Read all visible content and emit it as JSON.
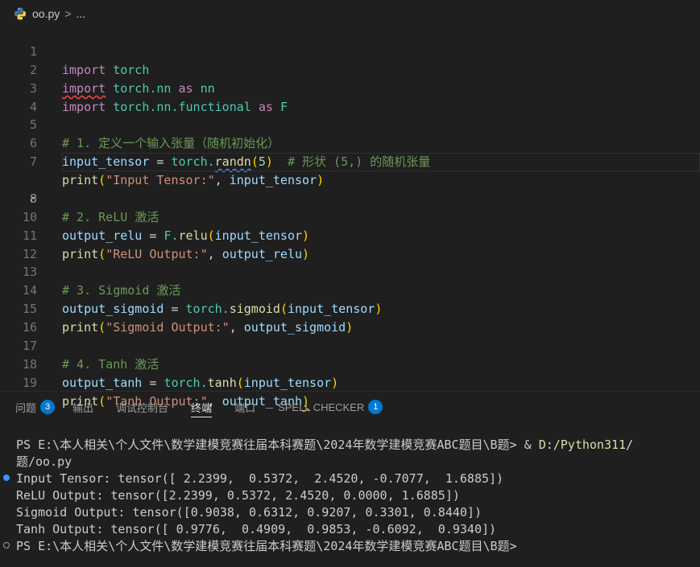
{
  "breadcrumb": {
    "file": "oo.py",
    "separator": ">",
    "more": "..."
  },
  "editor": {
    "lines": [
      {
        "n": "1"
      },
      {
        "n": "2"
      },
      {
        "n": "3"
      },
      {
        "n": "4"
      },
      {
        "n": "5"
      },
      {
        "n": "6"
      },
      {
        "n": "7"
      },
      {
        "n": "8"
      },
      {
        "n": "9"
      },
      {
        "n": "10"
      },
      {
        "n": "11"
      },
      {
        "n": "12"
      },
      {
        "n": "13"
      },
      {
        "n": "14"
      },
      {
        "n": "15"
      },
      {
        "n": "16"
      },
      {
        "n": "17"
      },
      {
        "n": "18"
      },
      {
        "n": "19"
      }
    ],
    "t": {
      "import": "import",
      "torch": "torch",
      "torch_nn": "torch.nn",
      "as": "as",
      "nn": "nn",
      "torch_nn_functional": "torch.nn.functional",
      "F": "F",
      "c1": "# 1. 定义一个输入张量（随机初始化）",
      "input_tensor": "input_tensor",
      "eq": " = ",
      "torch_dot": "torch.",
      "randn": "randn",
      "five": "5",
      "c6": "# 形状 (5,) 的随机张量",
      "print": "print",
      "s7": "\"Input Tensor:\"",
      "comma": ", ",
      "c9": "# 2. ReLU 激活",
      "output_relu": "output_relu",
      "F_dot": "F.",
      "relu": "relu",
      "s11": "\"ReLU Output:\"",
      "c13": "# 3. Sigmoid 激活",
      "output_sigmoid": "output_sigmoid",
      "sigmoid": "sigmoid",
      "s15": "\"Sigmoid Output:\"",
      "c17": "# 4. Tanh 激活",
      "output_tanh": "output_tanh",
      "tanh": "tanh",
      "s19": "\"Tanh Output:\""
    }
  },
  "panel": {
    "tabs": [
      {
        "label": "问题",
        "badge": "3"
      },
      {
        "label": "输出"
      },
      {
        "label": "调试控制台"
      },
      {
        "label": "终端"
      },
      {
        "label": "端口"
      },
      {
        "label": "SPELL CHECKER",
        "badge": "1"
      }
    ]
  },
  "terminal": {
    "prompt1": "PS E:\\本人相关\\个人文件\\数学建模竞赛往届本科赛题\\2024年数学建模竞赛ABC题目\\B题> & ",
    "cmd_path": "D:/Python311/",
    "wrap": "题/oo.py",
    "out1": "Input Tensor: tensor([ 2.2399,  0.5372,  2.4520, -0.7077,  1.6885])",
    "out2": "ReLU Output: tensor([2.2399, 0.5372, 2.4520, 0.0000, 1.6885])",
    "out3": "Sigmoid Output: tensor([0.9038, 0.6312, 0.9207, 0.3301, 0.8440])",
    "out4": "Tanh Output: tensor([ 0.9776,  0.4909,  0.9853, -0.6092,  0.9340])",
    "prompt2": "PS E:\\本人相关\\个人文件\\数学建模竞赛往届本科赛题\\2024年数学建模竞赛ABC题目\\B题>"
  },
  "icons": {
    "file_icon": "python-icon"
  },
  "colors": {
    "accent": "#0078d4",
    "background": "#1f1f1f"
  }
}
